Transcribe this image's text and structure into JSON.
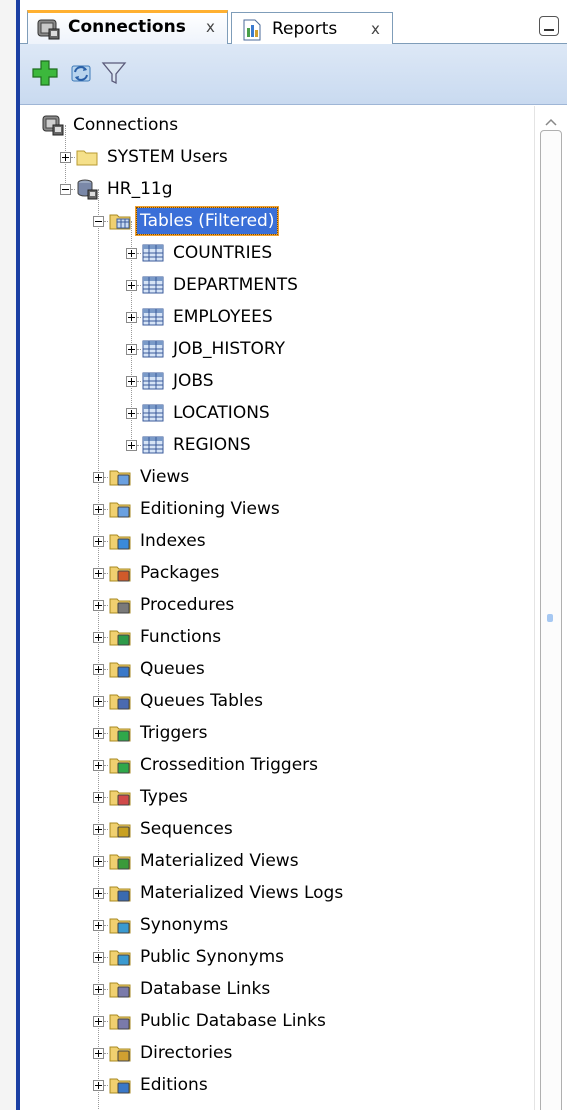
{
  "tabs": [
    {
      "label": "Connections",
      "close": "x",
      "active": true
    },
    {
      "label": "Reports",
      "close": "x",
      "active": false
    }
  ],
  "toolbar": {
    "buttons": [
      {
        "name": "add-connection-button",
        "icon": "green-plus-icon"
      },
      {
        "name": "refresh-button",
        "icon": "refresh-icon"
      },
      {
        "name": "filter-button",
        "icon": "filter-funnel-icon"
      }
    ]
  },
  "tree": {
    "root": "Connections",
    "connections": [
      {
        "label": "SYSTEM Users",
        "icon": "folder-icon",
        "expanded": false
      },
      {
        "label": "HR_11g",
        "icon": "database-icon",
        "expanded": true
      }
    ],
    "tables_node": {
      "label": "Tables (Filtered)",
      "selected": true,
      "expanded": true
    },
    "tables": [
      "COUNTRIES",
      "DEPARTMENTS",
      "EMPLOYEES",
      "JOB_HISTORY",
      "JOBS",
      "LOCATIONS",
      "REGIONS"
    ],
    "object_folders": [
      {
        "label": "Views",
        "icon": "views-folder-icon"
      },
      {
        "label": "Editioning Views",
        "icon": "editioning-views-folder-icon"
      },
      {
        "label": "Indexes",
        "icon": "indexes-folder-icon"
      },
      {
        "label": "Packages",
        "icon": "packages-folder-icon"
      },
      {
        "label": "Procedures",
        "icon": "procedures-folder-icon"
      },
      {
        "label": "Functions",
        "icon": "functions-folder-icon"
      },
      {
        "label": "Queues",
        "icon": "queues-folder-icon"
      },
      {
        "label": "Queues Tables",
        "icon": "queues-tables-folder-icon"
      },
      {
        "label": "Triggers",
        "icon": "triggers-folder-icon"
      },
      {
        "label": "Crossedition Triggers",
        "icon": "crossedition-triggers-folder-icon"
      },
      {
        "label": "Types",
        "icon": "types-folder-icon"
      },
      {
        "label": "Sequences",
        "icon": "sequences-folder-icon"
      },
      {
        "label": "Materialized Views",
        "icon": "materialized-views-folder-icon"
      },
      {
        "label": "Materialized Views Logs",
        "icon": "materialized-views-logs-folder-icon"
      },
      {
        "label": "Synonyms",
        "icon": "synonyms-folder-icon"
      },
      {
        "label": "Public Synonyms",
        "icon": "public-synonyms-folder-icon"
      },
      {
        "label": "Database Links",
        "icon": "database-links-folder-icon"
      },
      {
        "label": "Public Database Links",
        "icon": "public-database-links-folder-icon"
      },
      {
        "label": "Directories",
        "icon": "directories-folder-icon"
      },
      {
        "label": "Editions",
        "icon": "editions-folder-icon"
      }
    ]
  },
  "colors": {
    "selection": "#3a6fd8",
    "selection_outline": "#f0a030",
    "toolbar_bg": "#c9daf0",
    "active_tab_accent": "#ffb030",
    "left_border": "#1a3fa3"
  }
}
